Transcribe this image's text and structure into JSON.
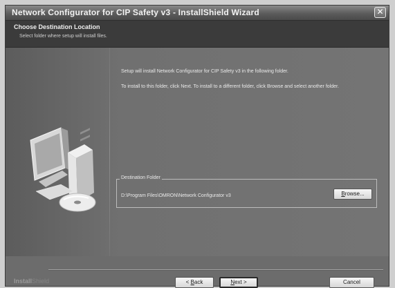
{
  "window": {
    "title": "Network Configurator for CIP Safety v3 - InstallShield Wizard",
    "close_glyph": "✕"
  },
  "header": {
    "title": "Choose Destination Location",
    "subtitle": "Select folder where setup will install files."
  },
  "content": {
    "description_1": "Setup will install Network Configurator for CIP Safety v3 in the following folder.",
    "description_2": "To install to this folder, click Next. To install to a different folder, click Browse and select another folder.",
    "destination_group_label": "Destination Folder",
    "destination_path": "D:\\Program Files\\OMRON\\Network Configurator v3",
    "browse_label_prefix": "",
    "browse_label_underlined": "B",
    "browse_label_rest": "rowse..."
  },
  "footer": {
    "brand_bold": "Install",
    "brand_light": "Shield",
    "back_prefix": "< ",
    "back_underlined": "B",
    "back_rest": "ack",
    "next_underlined": "N",
    "next_rest": "ext >",
    "cancel_label": "Cancel"
  },
  "icons": {
    "computer_art": "computer-with-cd-icon"
  }
}
